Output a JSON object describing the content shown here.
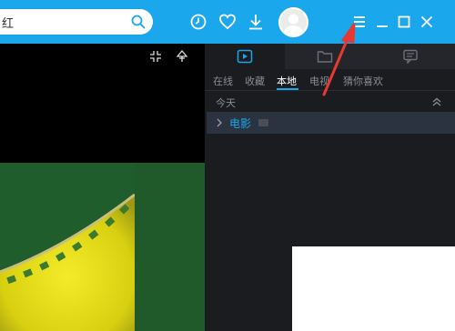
{
  "search": {
    "value": "红"
  },
  "topbar_icons": [
    "search-icon",
    "history-icon",
    "heart-icon",
    "download-icon",
    "avatar",
    "menu-icon",
    "minimize-icon",
    "maximize-icon",
    "close-icon"
  ],
  "panel": {
    "top_tabs": [
      "play-list-icon",
      "folder-icon",
      "chat-icon"
    ],
    "subtabs": [
      {
        "label": "在线",
        "active": false
      },
      {
        "label": "收藏",
        "active": false
      },
      {
        "label": "本地",
        "active": true
      },
      {
        "label": "电视",
        "active": false
      },
      {
        "label": "猜你喜欢",
        "active": false
      }
    ],
    "section_title": "今天",
    "folder": {
      "label": "电影"
    }
  },
  "colors": {
    "accent": "#1aa7ec",
    "panel_bg": "#1b1c20",
    "arrow": "#e53935"
  }
}
